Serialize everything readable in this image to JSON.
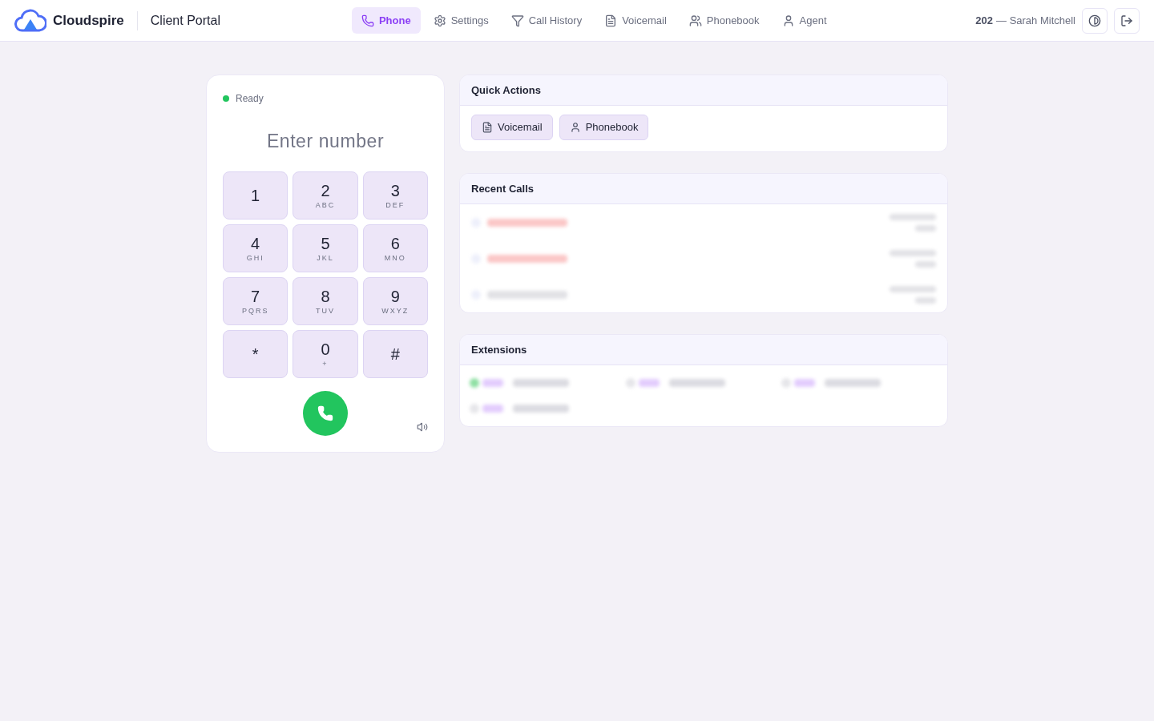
{
  "header": {
    "brand": "Cloudspire",
    "portal": "Client Portal",
    "nav": [
      {
        "label": "Phone",
        "selected": true
      },
      {
        "label": "Settings",
        "selected": false
      },
      {
        "label": "Call History",
        "selected": false
      },
      {
        "label": "Voicemail",
        "selected": false
      },
      {
        "label": "Phonebook",
        "selected": false
      },
      {
        "label": "Agent",
        "selected": false
      }
    ],
    "user_ext": "202",
    "user_name": "— Sarah Mitchell"
  },
  "dialer": {
    "status": "Ready",
    "online": true,
    "placeholder": "Enter number",
    "keys": [
      {
        "digit": "1"
      },
      {
        "digit": "2",
        "letters": "ABC"
      },
      {
        "digit": "3",
        "letters": "DEF"
      },
      {
        "digit": "4",
        "letters": "GHI"
      },
      {
        "digit": "5",
        "letters": "JKL"
      },
      {
        "digit": "6",
        "letters": "MNO"
      },
      {
        "digit": "7",
        "letters": "PQRS"
      },
      {
        "digit": "8",
        "letters": "TUV"
      },
      {
        "digit": "9",
        "letters": "WXYZ"
      },
      {
        "digit": "*"
      },
      {
        "digit": "0",
        "letters": "+"
      },
      {
        "digit": "#"
      }
    ]
  },
  "quick_actions": {
    "title": "Quick Actions",
    "buttons": [
      {
        "label": "Voicemail"
      },
      {
        "label": "Phonebook"
      }
    ]
  },
  "recent_calls": {
    "title": "Recent Calls",
    "rows": [
      {
        "kind": "missed"
      },
      {
        "kind": "missed"
      },
      {
        "kind": "answered"
      }
    ]
  },
  "extensions": {
    "title": "Extensions",
    "items": [
      {
        "kind": "available"
      },
      {
        "kind": "offline"
      },
      {
        "kind": "offline"
      },
      {
        "kind": "offline"
      }
    ]
  }
}
